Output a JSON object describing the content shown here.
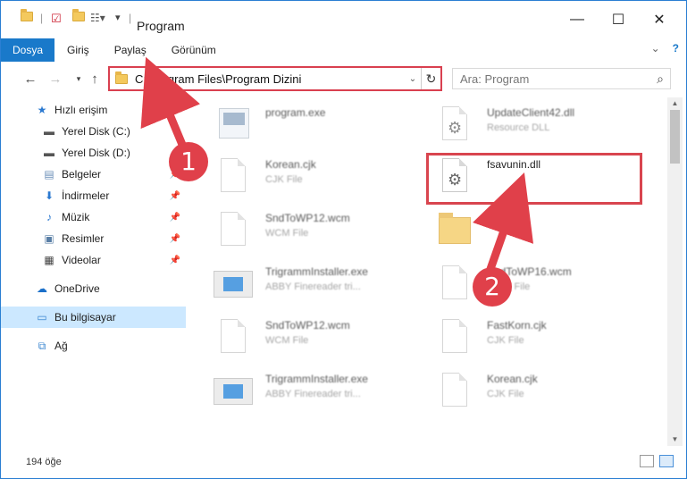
{
  "window": {
    "title": "Program"
  },
  "ribbon": {
    "tabs": [
      {
        "label": "Dosya",
        "active": true
      },
      {
        "label": "Giriş"
      },
      {
        "label": "Paylaş"
      },
      {
        "label": "Görünüm"
      }
    ]
  },
  "address": {
    "path": "C:\\Program Files\\Program Dizini"
  },
  "search": {
    "placeholder": "Ara: Program"
  },
  "sidebar": {
    "items": [
      {
        "label": "Hızlı erişim",
        "icon": "star-icon"
      },
      {
        "label": "Yerel Disk (C:)",
        "icon": "drive-icon"
      },
      {
        "label": "Yerel Disk (D:)",
        "icon": "drive-icon"
      },
      {
        "label": "Belgeler",
        "icon": "documents-icon"
      },
      {
        "label": "İndirmeler",
        "icon": "download-icon"
      },
      {
        "label": "Müzik",
        "icon": "music-icon"
      },
      {
        "label": "Resimler",
        "icon": "pictures-icon"
      },
      {
        "label": "Videolar",
        "icon": "video-icon"
      },
      {
        "label": "OneDrive",
        "icon": "cloud-icon"
      },
      {
        "label": "Bu bilgisayar",
        "icon": "computer-icon",
        "selected": true
      },
      {
        "label": "Ağ",
        "icon": "network-icon"
      }
    ]
  },
  "files": [
    {
      "name": "program.exe",
      "meta": ""
    },
    {
      "name": "UpdateClient42.dll",
      "meta": "Resource DLL"
    },
    {
      "name": "Korean.cjk",
      "meta": "CJK File"
    },
    {
      "name": "fsavunin.dll",
      "meta": ""
    },
    {
      "name": "SndToWP12.wcm",
      "meta": "WCM File"
    },
    {
      "name": "x64",
      "meta": ""
    },
    {
      "name": "TrigrammInstaller.exe",
      "meta": "ABBY Finereader tri..."
    },
    {
      "name": "SndToWP16.wcm",
      "meta": "WCM File"
    },
    {
      "name": "SndToWP12.wcm",
      "meta": "WCM File"
    },
    {
      "name": "FastKorn.cjk",
      "meta": "CJK File"
    },
    {
      "name": "TrigrammInstaller.exe",
      "meta": "ABBY Finereader tri..."
    },
    {
      "name": "Korean.cjk",
      "meta": "CJK File"
    }
  ],
  "status": {
    "count": "194 öğe"
  },
  "annotations": {
    "badge1": "1",
    "badge2": "2"
  },
  "colors": {
    "accent": "#1979ca",
    "highlight": "#d9454f",
    "selection": "#cce8ff"
  }
}
